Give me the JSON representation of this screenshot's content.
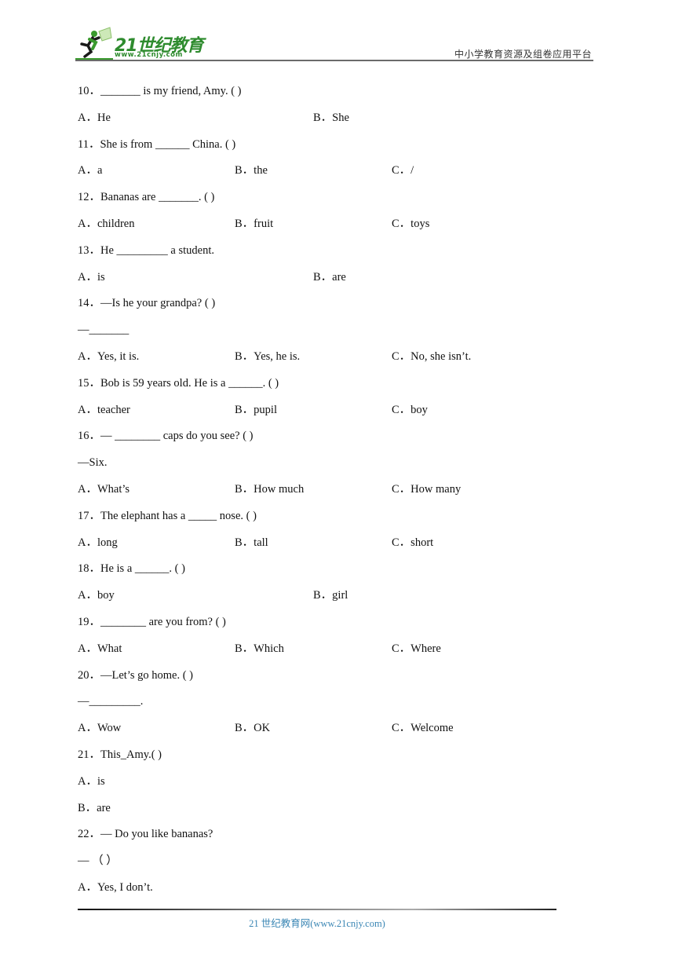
{
  "header": {
    "logo_text": "21世纪教育",
    "logo_url": "www.21cnjy.com",
    "platform": "中小学教育资源及组卷应用平台"
  },
  "questions": [
    {
      "number": "10．",
      "stem": "_______ is my friend, Amy. (    )",
      "lines": [],
      "options": [
        {
          "letter": "A．",
          "text": "He"
        },
        {
          "letter": "B．",
          "text": "She"
        }
      ]
    },
    {
      "number": "11．",
      "stem": "She is from ______ China. (     )",
      "lines": [],
      "options": [
        {
          "letter": "A．",
          "text": "a"
        },
        {
          "letter": "B．",
          "text": "the"
        },
        {
          "letter": "C．",
          "text": "/"
        }
      ]
    },
    {
      "number": "12．",
      "stem": "Bananas are _______. (     )",
      "lines": [],
      "options": [
        {
          "letter": "A．",
          "text": "children"
        },
        {
          "letter": "B．",
          "text": "fruit"
        },
        {
          "letter": "C．",
          "text": "toys"
        }
      ]
    },
    {
      "number": "13．",
      "stem": "He _________ a student.",
      "lines": [],
      "options": [
        {
          "letter": "A．",
          "text": "is"
        },
        {
          "letter": "B．",
          "text": "are"
        }
      ]
    },
    {
      "number": "14．",
      "stem": "—Is he your grandpa? (     )",
      "lines": [
        "—_______"
      ],
      "options": [
        {
          "letter": "A．",
          "text": "Yes, it is."
        },
        {
          "letter": "B．",
          "text": "Yes, he is."
        },
        {
          "letter": "C．",
          "text": "No, she isn’t."
        }
      ]
    },
    {
      "number": "15．",
      "stem": "Bob is 59 years old. He is a ______. (     )",
      "lines": [],
      "options": [
        {
          "letter": "A．",
          "text": "teacher"
        },
        {
          "letter": "B．",
          "text": "pupil"
        },
        {
          "letter": "C．",
          "text": "boy"
        }
      ]
    },
    {
      "number": "16．",
      "stem": "— ________ caps do you see?    (     )",
      "lines": [
        "—Six."
      ],
      "options": [
        {
          "letter": "A．",
          "text": "What’s"
        },
        {
          "letter": "B．",
          "text": "How much"
        },
        {
          "letter": "C．",
          "text": "How many"
        }
      ]
    },
    {
      "number": "17．",
      "stem": "The elephant has a _____ nose. (     )",
      "lines": [],
      "options": [
        {
          "letter": "A．",
          "text": "long"
        },
        {
          "letter": "B．",
          "text": "tall"
        },
        {
          "letter": "C．",
          "text": "short"
        }
      ]
    },
    {
      "number": "18．",
      "stem": "He is a ______. (    )",
      "lines": [],
      "options": [
        {
          "letter": "A．",
          "text": "boy"
        },
        {
          "letter": "B．",
          "text": "girl"
        }
      ]
    },
    {
      "number": "19．",
      "stem": "________ are you from? (     )",
      "lines": [],
      "options": [
        {
          "letter": "A．",
          "text": "What"
        },
        {
          "letter": "B．",
          "text": "Which"
        },
        {
          "letter": "C．",
          "text": "Where"
        }
      ]
    },
    {
      "number": "20．",
      "stem": "—Let’s go home.  (    )",
      "lines": [
        "—_________."
      ],
      "options": [
        {
          "letter": "A．",
          "text": "Wow"
        },
        {
          "letter": "B．",
          "text": "OK"
        },
        {
          "letter": "C．",
          "text": "Welcome"
        }
      ]
    },
    {
      "number": "21．",
      "stem": "This_Amy.(    )",
      "lines": [],
      "options_stacked": true,
      "options": [
        {
          "letter": "A．",
          "text": "is"
        },
        {
          "letter": "B．",
          "text": "are"
        }
      ]
    },
    {
      "number": "22．",
      "stem": "— Do you like bananas?",
      "lines": [
        "—  （    ）"
      ],
      "options_stacked": true,
      "options": [
        {
          "letter": "A．",
          "text": "Yes, I don’t."
        }
      ]
    }
  ],
  "footer": {
    "text": "21 世纪教育网(www.21cnjy.com)"
  }
}
